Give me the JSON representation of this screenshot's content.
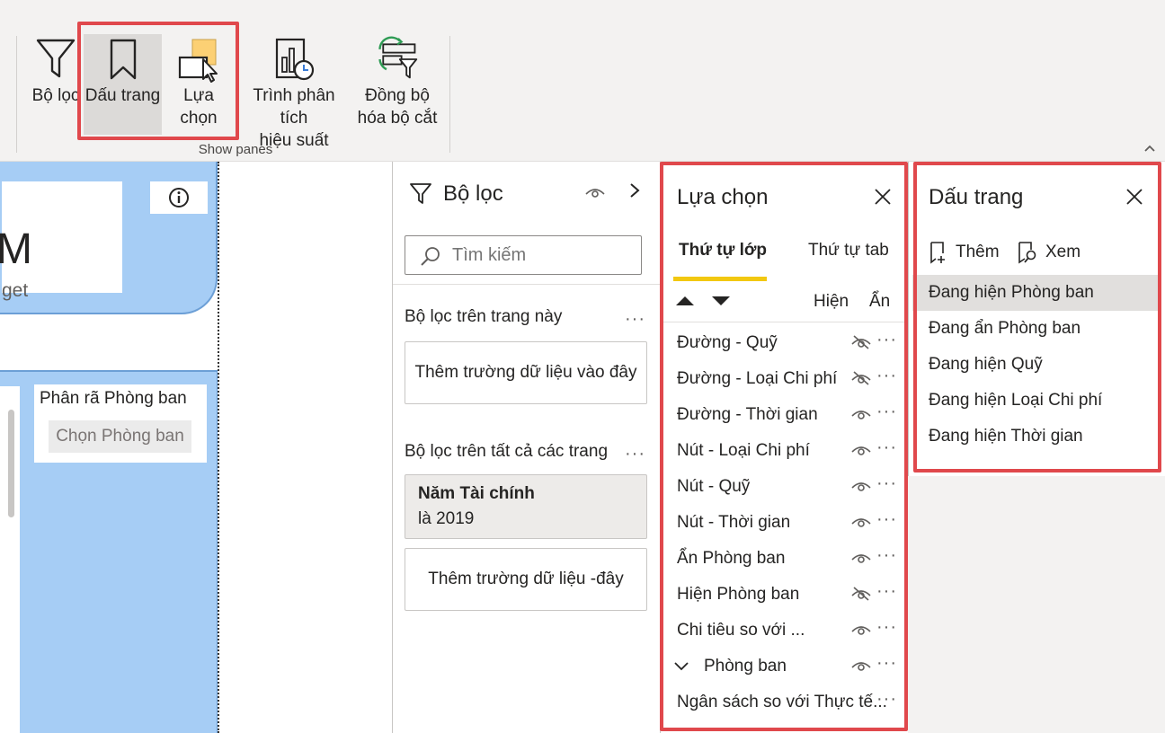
{
  "ribbon": {
    "buttons": [
      {
        "id": "filter",
        "label": "Bộ lọc",
        "icon": "funnel-icon"
      },
      {
        "id": "bookmark",
        "label": "Dấu trang",
        "icon": "bookmark-icon"
      },
      {
        "id": "selection",
        "label": "Lựa chọn",
        "icon": "selection-icon"
      },
      {
        "id": "performance",
        "label_line1": "Trình phân tích",
        "label_line2": "hiệu suất",
        "icon": "performance-analyzer-icon"
      },
      {
        "id": "sync",
        "label_line1": "Đồng bộ",
        "label_line2": "hóa bộ cắt",
        "icon": "sync-slicers-icon"
      }
    ],
    "group_label": "Show panes",
    "collapse_glyph": "^"
  },
  "canvas": {
    "kpi_value": "M",
    "kpi_subtitle": "get",
    "info_glyph": "i",
    "slicer": {
      "title": "Phân rã Phòng ban",
      "placeholder": "Chọn Phòng ban"
    }
  },
  "filters_pane": {
    "title": "Bộ lọc",
    "search_placeholder": "Tìm kiếm",
    "page_section": "Bộ lọc trên trang này",
    "page_add_field": "Thêm trường dữ liệu vào đây",
    "all_section": "Bộ lọc trên tất cả các trang",
    "card": {
      "title": "Năm Tài chính",
      "value": "là 2019"
    },
    "all_add_field": "Thêm trường dữ liệu -đây",
    "more": "···"
  },
  "selection_pane": {
    "title": "Lựa chọn",
    "tabs": [
      "Thứ tự lớp",
      "Thứ tự tab"
    ],
    "show_label": "Hiện",
    "hide_label": "Ẩn",
    "items": [
      {
        "label": "Đường - Quỹ",
        "visible": false
      },
      {
        "label": "Đường - Loại Chi phí",
        "visible": false
      },
      {
        "label": "Đường - Thời gian",
        "visible": true
      },
      {
        "label": "Nút - Loại Chi phí",
        "visible": true
      },
      {
        "label": "Nút - Quỹ",
        "visible": true
      },
      {
        "label": "Nút - Thời gian",
        "visible": true
      },
      {
        "label": "Ẩn Phòng ban",
        "visible": true
      },
      {
        "label": "Hiện Phòng ban",
        "visible": false
      },
      {
        "label": "Chi tiêu so với ...",
        "visible": true
      },
      {
        "label": "Phòng ban",
        "visible": true,
        "group": true
      },
      {
        "label": "Ngân sách so với Thực tế...",
        "visible": null
      }
    ],
    "more": "···"
  },
  "bookmarks_pane": {
    "title": "Dấu trang",
    "add_label": "Thêm",
    "view_label": "Xem",
    "items": [
      "Đang hiện Phòng ban",
      "Đang ẩn Phòng ban",
      "Đang hiện Quỹ",
      "Đang hiện Loại Chi phí",
      "Đang hiện Thời gian"
    ],
    "active_index": 0
  },
  "colors": {
    "highlight_box": "#e0484c",
    "tab_underline": "#f2c811",
    "canvas_card": "#a6cdf5"
  }
}
